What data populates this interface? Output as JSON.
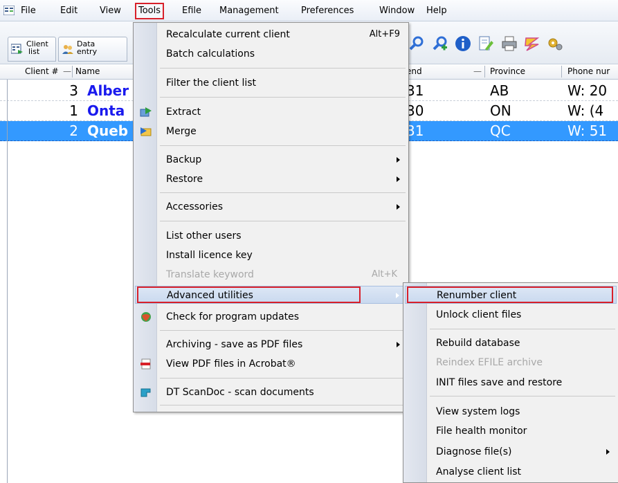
{
  "menubar": {
    "items": [
      "File",
      "Edit",
      "View",
      "Tools",
      "Efile",
      "Management",
      "Preferences",
      "Window",
      "Help"
    ]
  },
  "toolbar": {
    "tabs": [
      {
        "line1": "Client",
        "line2": "list"
      },
      {
        "line1": "Data",
        "line2": "entry"
      }
    ]
  },
  "list": {
    "columns": [
      "Client #",
      "Name",
      "end",
      "Province",
      "Phone nur"
    ],
    "rows": [
      {
        "num": "3",
        "name": "Alber",
        "year_end": "31",
        "province": "AB",
        "phone": "W: 20",
        "selected": false
      },
      {
        "num": "1",
        "name": "Onta",
        "year_end": "30",
        "province": "ON",
        "phone": "W: (4",
        "selected": false
      },
      {
        "num": "2",
        "name": "Queb",
        "year_end": "31",
        "province": "QC",
        "phone": "W: 51",
        "selected": true
      }
    ]
  },
  "tools_menu": {
    "items": [
      {
        "label": "Recalculate current client",
        "shortcut": "Alt+F9"
      },
      {
        "label": "Batch calculations"
      },
      {
        "label": "Filter the client list"
      },
      {
        "label": "Extract"
      },
      {
        "label": "Merge"
      },
      {
        "label": "Backup"
      },
      {
        "label": "Restore"
      },
      {
        "label": "Accessories"
      },
      {
        "label": "List other users"
      },
      {
        "label": "Install licence key"
      },
      {
        "label": "Translate keyword",
        "shortcut": "Alt+K"
      },
      {
        "label": "Advanced utilities"
      },
      {
        "label": "Check for program updates"
      },
      {
        "label": "Archiving - save as PDF files"
      },
      {
        "label": "View PDF files in Acrobat®"
      },
      {
        "label": "DT ScanDoc - scan documents"
      }
    ]
  },
  "advanced_menu": {
    "items": [
      {
        "label": "Renumber client"
      },
      {
        "label": "Unlock client files"
      },
      {
        "label": "Rebuild database"
      },
      {
        "label": "Reindex EFILE archive"
      },
      {
        "label": "INIT files save and restore"
      },
      {
        "label": "View system logs"
      },
      {
        "label": "File health monitor"
      },
      {
        "label": "Diagnose file(s)"
      },
      {
        "label": "Analyse client list"
      }
    ]
  },
  "colors": {
    "highlight_box": "#d8202a",
    "selection": "#3399ff",
    "name_text": "#1a1aee"
  }
}
